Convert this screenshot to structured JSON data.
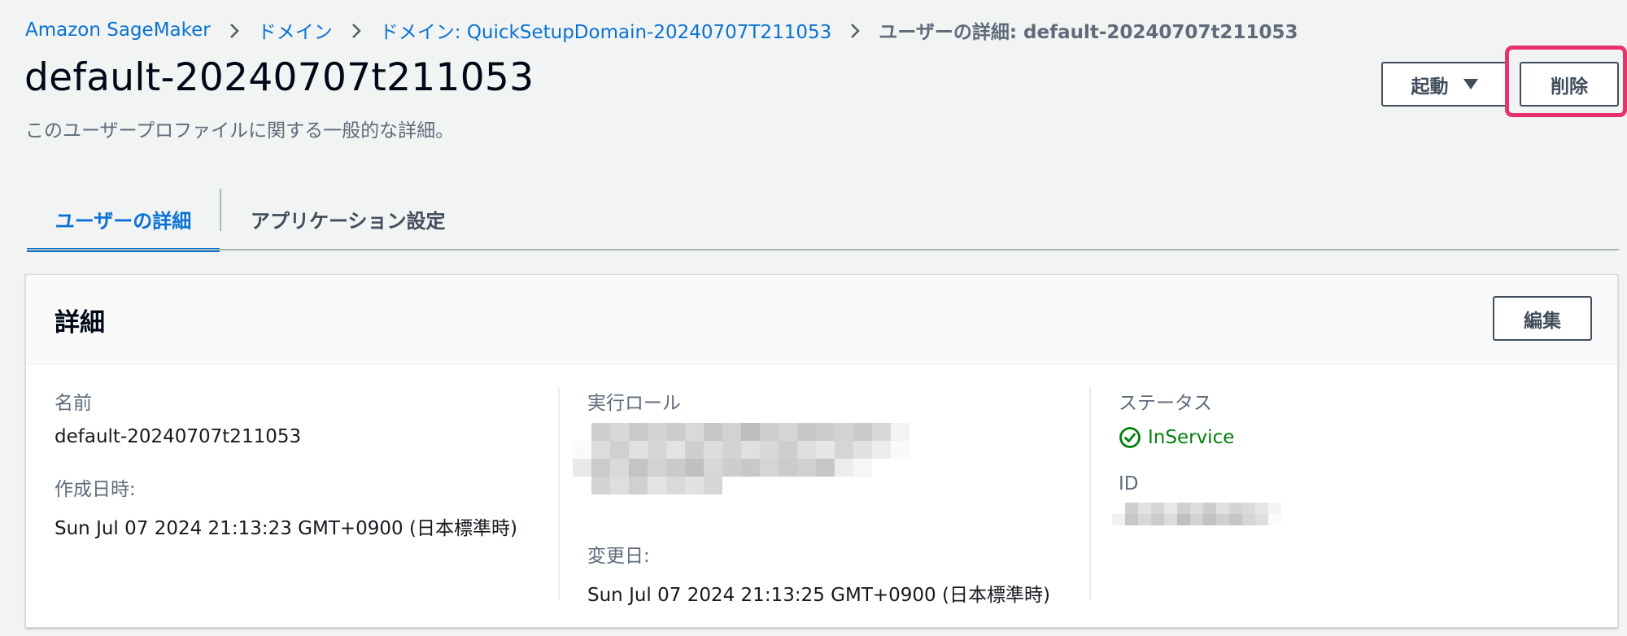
{
  "breadcrumb": {
    "items": [
      "Amazon SageMaker",
      "ドメイン",
      "ドメイン: QuickSetupDomain-20240707T211053"
    ],
    "current": "ユーザーの詳細: default-20240707t211053"
  },
  "header": {
    "title": "default-20240707t211053",
    "description": "このユーザープロファイルに関する一般的な詳細。",
    "launch_label": "起動",
    "delete_label": "削除"
  },
  "tabs": [
    {
      "label": "ユーザーの詳細",
      "active": true
    },
    {
      "label": "アプリケーション設定",
      "active": false
    }
  ],
  "details": {
    "title": "詳細",
    "edit_label": "編集",
    "name_label": "名前",
    "name_value": "default-20240707t211053",
    "created_label": "作成日時:",
    "created_value": "Sun Jul 07 2024 21:13:23 GMT+0900 (日本標準時)",
    "role_label": "実行ロール",
    "modified_label": "変更日:",
    "modified_value": "Sun Jul 07 2024 21:13:25 GMT+0900 (日本標準時)",
    "status_label": "ステータス",
    "status_value": "InService",
    "id_label": "ID"
  },
  "colors": {
    "link": "#0972d3",
    "status_ok": "#037f0c",
    "highlight": "#e8316f"
  },
  "icons": [
    "chevron-right-icon",
    "caret-down-icon",
    "status-success-icon"
  ]
}
